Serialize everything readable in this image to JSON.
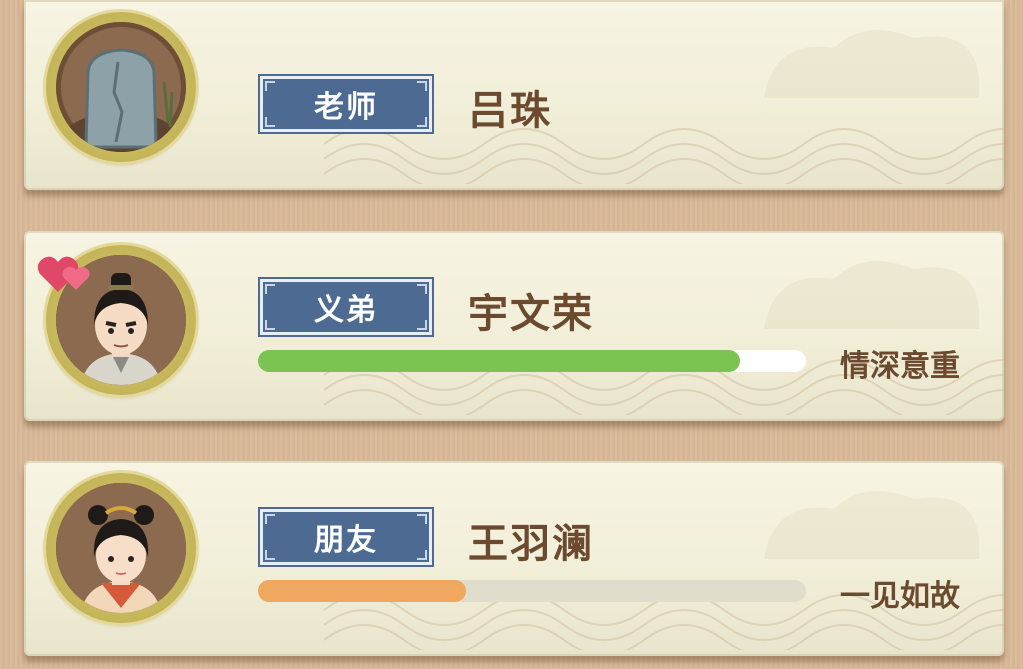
{
  "relations": [
    {
      "tag": "老师",
      "name": "吕珠",
      "avatar": "tombstone-avatar"
    },
    {
      "tag": "义弟",
      "name": "宇文荣",
      "avatar": "male-avatar",
      "status": "情深意重",
      "progress": 0.88,
      "bar_color": "#7cc452",
      "icon": "hearts-icon"
    },
    {
      "tag": "朋友",
      "name": "王羽澜",
      "avatar": "female-avatar",
      "status": "一见如故",
      "progress": 0.38,
      "bar_color": "#f0a860"
    }
  ]
}
